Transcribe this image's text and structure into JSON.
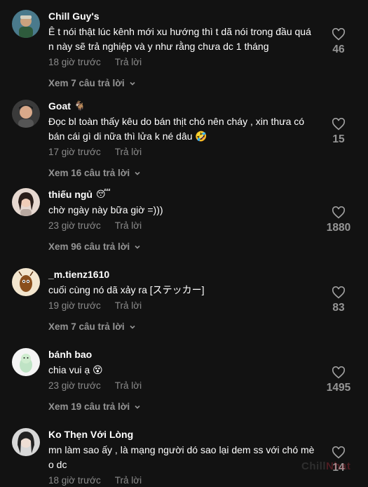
{
  "comments": [
    {
      "username": "Chill Guy's",
      "emoji": "",
      "text": "Ê t nói thật lúc kênh mới xu hướng thì t dã nói trong đầu quá n này sẽ trả nghiệp và y như rằng chưa dc 1 tháng",
      "time": "18 giờ trước",
      "reply_label": "Trả lời",
      "view_replies": "Xem 7 câu trả lời",
      "likes": "46"
    },
    {
      "username": "Goat",
      "emoji": "🐐",
      "text": "Đọc bl toàn thấy kêu do bán thịt chó nên cháy , xin thưa có bán cái gì di nữa thì lửa k né dâu 🤣",
      "time": "17 giờ trước",
      "reply_label": "Trả lời",
      "view_replies": "Xem 16 câu trả lời",
      "likes": "15"
    },
    {
      "username": "thiếu ngủ",
      "emoji": "😴",
      "text": "chờ ngày này bữa giờ =)))",
      "time": "23 giờ trước",
      "reply_label": "Trả lời",
      "view_replies": "Xem 96 câu trả lời",
      "likes": "1880"
    },
    {
      "username": "_m.tienz1610",
      "emoji": "",
      "text": "cuối cùng nó dã xảy ra [ステッカー]",
      "time": "19 giờ trước",
      "reply_label": "Trả lời",
      "view_replies": "Xem 7 câu trả lời",
      "likes": "83"
    },
    {
      "username": "bánh bao",
      "emoji": "",
      "text": "chia vui ạ 😵",
      "time": "23 giờ trước",
      "reply_label": "Trả lời",
      "view_replies": "Xem 19 câu trả lời",
      "likes": "1495"
    },
    {
      "username": "Ko Thẹn Với Lòng",
      "emoji": "",
      "text": "mn làm sao ấy , là mạng người dó sao lại dem ss với chó mè o dc",
      "time": "18 giờ trước",
      "reply_label": "Trả lời",
      "view_replies": "",
      "likes": "14"
    }
  ],
  "watermark": {
    "part1": "Chill",
    "part2": "Nhat"
  }
}
